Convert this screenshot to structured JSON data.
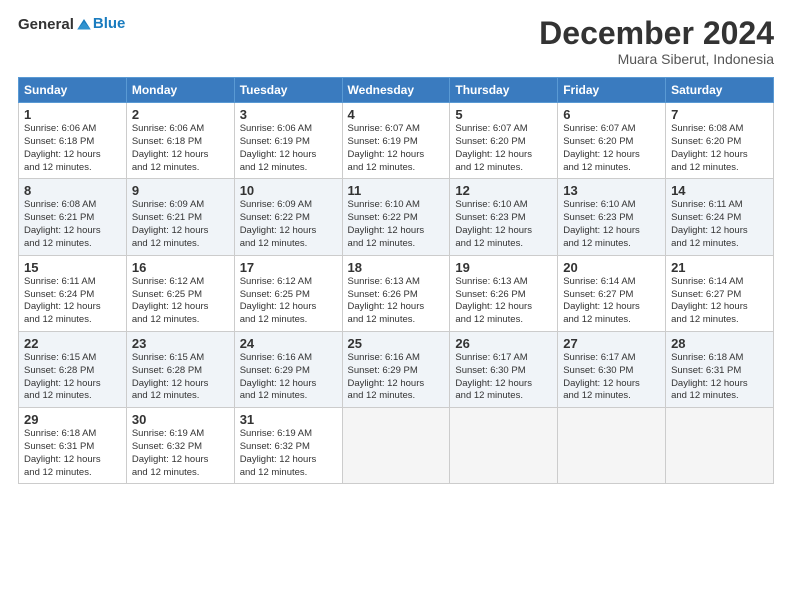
{
  "logo": {
    "line1": "General",
    "line2": "Blue"
  },
  "title": "December 2024",
  "subtitle": "Muara Siberut, Indonesia",
  "days_header": [
    "Sunday",
    "Monday",
    "Tuesday",
    "Wednesday",
    "Thursday",
    "Friday",
    "Saturday"
  ],
  "weeks": [
    [
      {
        "day": "1",
        "info": "Sunrise: 6:06 AM\nSunset: 6:18 PM\nDaylight: 12 hours\nand 12 minutes."
      },
      {
        "day": "2",
        "info": "Sunrise: 6:06 AM\nSunset: 6:18 PM\nDaylight: 12 hours\nand 12 minutes."
      },
      {
        "day": "3",
        "info": "Sunrise: 6:06 AM\nSunset: 6:19 PM\nDaylight: 12 hours\nand 12 minutes."
      },
      {
        "day": "4",
        "info": "Sunrise: 6:07 AM\nSunset: 6:19 PM\nDaylight: 12 hours\nand 12 minutes."
      },
      {
        "day": "5",
        "info": "Sunrise: 6:07 AM\nSunset: 6:20 PM\nDaylight: 12 hours\nand 12 minutes."
      },
      {
        "day": "6",
        "info": "Sunrise: 6:07 AM\nSunset: 6:20 PM\nDaylight: 12 hours\nand 12 minutes."
      },
      {
        "day": "7",
        "info": "Sunrise: 6:08 AM\nSunset: 6:20 PM\nDaylight: 12 hours\nand 12 minutes."
      }
    ],
    [
      {
        "day": "8",
        "info": "Sunrise: 6:08 AM\nSunset: 6:21 PM\nDaylight: 12 hours\nand 12 minutes."
      },
      {
        "day": "9",
        "info": "Sunrise: 6:09 AM\nSunset: 6:21 PM\nDaylight: 12 hours\nand 12 minutes."
      },
      {
        "day": "10",
        "info": "Sunrise: 6:09 AM\nSunset: 6:22 PM\nDaylight: 12 hours\nand 12 minutes."
      },
      {
        "day": "11",
        "info": "Sunrise: 6:10 AM\nSunset: 6:22 PM\nDaylight: 12 hours\nand 12 minutes."
      },
      {
        "day": "12",
        "info": "Sunrise: 6:10 AM\nSunset: 6:23 PM\nDaylight: 12 hours\nand 12 minutes."
      },
      {
        "day": "13",
        "info": "Sunrise: 6:10 AM\nSunset: 6:23 PM\nDaylight: 12 hours\nand 12 minutes."
      },
      {
        "day": "14",
        "info": "Sunrise: 6:11 AM\nSunset: 6:24 PM\nDaylight: 12 hours\nand 12 minutes."
      }
    ],
    [
      {
        "day": "15",
        "info": "Sunrise: 6:11 AM\nSunset: 6:24 PM\nDaylight: 12 hours\nand 12 minutes."
      },
      {
        "day": "16",
        "info": "Sunrise: 6:12 AM\nSunset: 6:25 PM\nDaylight: 12 hours\nand 12 minutes."
      },
      {
        "day": "17",
        "info": "Sunrise: 6:12 AM\nSunset: 6:25 PM\nDaylight: 12 hours\nand 12 minutes."
      },
      {
        "day": "18",
        "info": "Sunrise: 6:13 AM\nSunset: 6:26 PM\nDaylight: 12 hours\nand 12 minutes."
      },
      {
        "day": "19",
        "info": "Sunrise: 6:13 AM\nSunset: 6:26 PM\nDaylight: 12 hours\nand 12 minutes."
      },
      {
        "day": "20",
        "info": "Sunrise: 6:14 AM\nSunset: 6:27 PM\nDaylight: 12 hours\nand 12 minutes."
      },
      {
        "day": "21",
        "info": "Sunrise: 6:14 AM\nSunset: 6:27 PM\nDaylight: 12 hours\nand 12 minutes."
      }
    ],
    [
      {
        "day": "22",
        "info": "Sunrise: 6:15 AM\nSunset: 6:28 PM\nDaylight: 12 hours\nand 12 minutes."
      },
      {
        "day": "23",
        "info": "Sunrise: 6:15 AM\nSunset: 6:28 PM\nDaylight: 12 hours\nand 12 minutes."
      },
      {
        "day": "24",
        "info": "Sunrise: 6:16 AM\nSunset: 6:29 PM\nDaylight: 12 hours\nand 12 minutes."
      },
      {
        "day": "25",
        "info": "Sunrise: 6:16 AM\nSunset: 6:29 PM\nDaylight: 12 hours\nand 12 minutes."
      },
      {
        "day": "26",
        "info": "Sunrise: 6:17 AM\nSunset: 6:30 PM\nDaylight: 12 hours\nand 12 minutes."
      },
      {
        "day": "27",
        "info": "Sunrise: 6:17 AM\nSunset: 6:30 PM\nDaylight: 12 hours\nand 12 minutes."
      },
      {
        "day": "28",
        "info": "Sunrise: 6:18 AM\nSunset: 6:31 PM\nDaylight: 12 hours\nand 12 minutes."
      }
    ],
    [
      {
        "day": "29",
        "info": "Sunrise: 6:18 AM\nSunset: 6:31 PM\nDaylight: 12 hours\nand 12 minutes."
      },
      {
        "day": "30",
        "info": "Sunrise: 6:19 AM\nSunset: 6:32 PM\nDaylight: 12 hours\nand 12 minutes."
      },
      {
        "day": "31",
        "info": "Sunrise: 6:19 AM\nSunset: 6:32 PM\nDaylight: 12 hours\nand 12 minutes."
      },
      null,
      null,
      null,
      null
    ]
  ]
}
